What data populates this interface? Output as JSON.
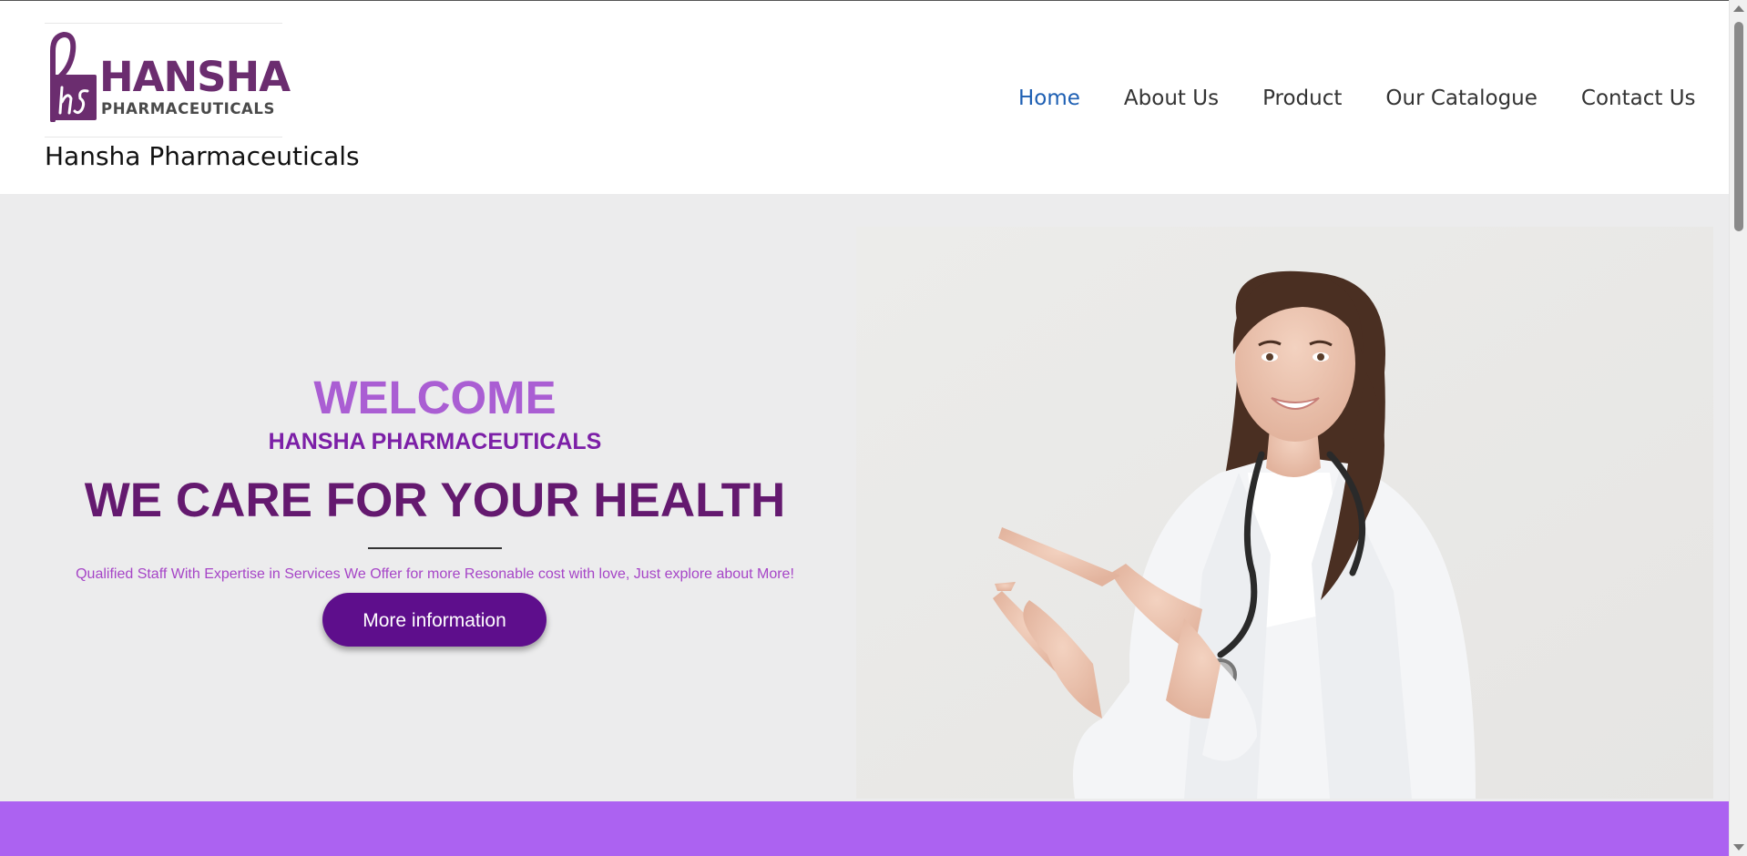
{
  "header": {
    "logo": {
      "wordmark": "HANSHA",
      "subline": "PHARMACEUTICALS",
      "monogram": "hs"
    },
    "site_title": "Hansha Pharmaceuticals"
  },
  "nav": {
    "items": [
      {
        "label": "Home",
        "active": true
      },
      {
        "label": "About Us"
      },
      {
        "label": "Product"
      },
      {
        "label": "Our Catalogue"
      },
      {
        "label": "Contact Us"
      }
    ]
  },
  "hero": {
    "welcome": "WELCOME",
    "company": "HANSHA PHARMACEUTICALS",
    "tagline": "WE CARE FOR YOUR HEALTH",
    "description": "Qualified Staff With Expertise in Services We Offer for more Resonable cost with love, Just explore about More!",
    "button_label": "More information"
  },
  "colors": {
    "brand_purple": "#6b2d6f",
    "welcome": "#aa5ed3",
    "company": "#7c1fa7",
    "tagline": "#64196f",
    "button": "#5e0e8c",
    "nav_active": "#1d5fb3",
    "band": "#ac62f1"
  },
  "icons": [
    "scroll-up-arrow-icon",
    "scroll-down-arrow-icon"
  ]
}
